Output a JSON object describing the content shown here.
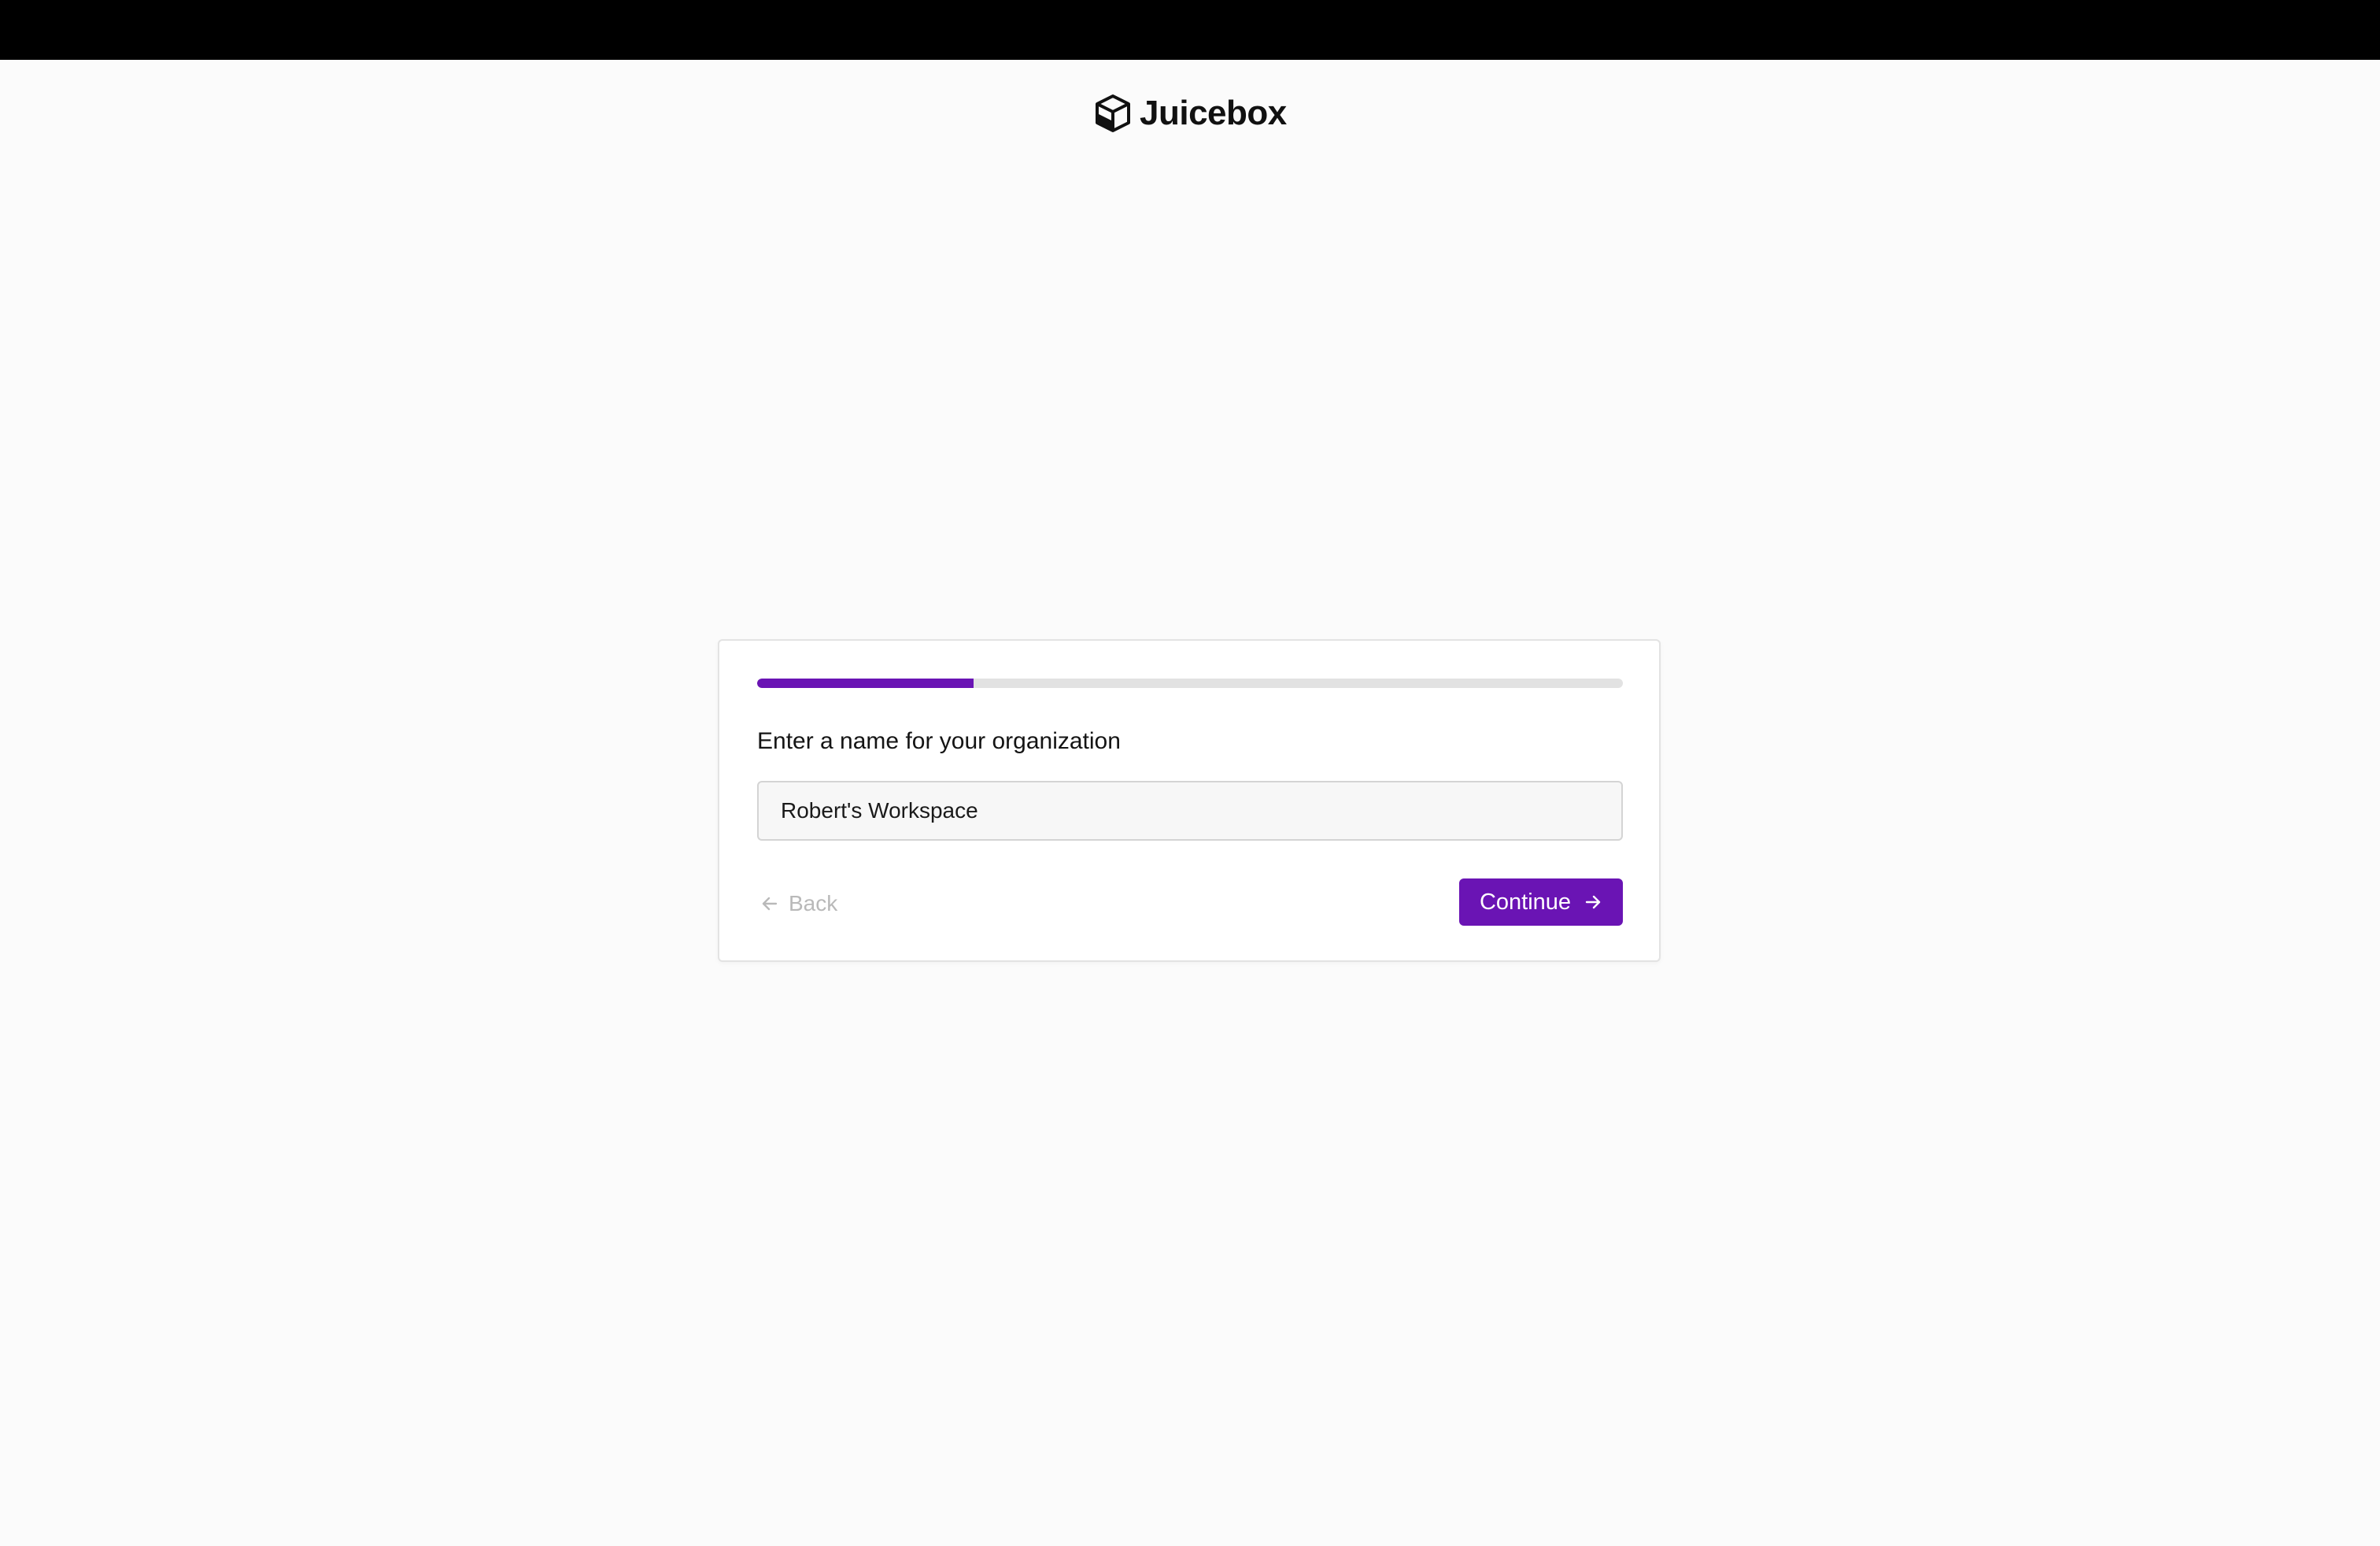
{
  "brand": {
    "name": "Juicebox",
    "logo_icon": "cube-icon"
  },
  "onboarding": {
    "progress_fraction": 0.25,
    "prompt": "Enter a name for your organization",
    "org_name_value": "Robert's Workspace",
    "back_label": "Back",
    "back_icon": "arrow-left-icon",
    "continue_label": "Continue",
    "continue_icon": "arrow-right-icon"
  },
  "colors": {
    "accent": "#6a14b4",
    "progress_track": "#e2e2e2",
    "top_bar": "#000000",
    "page_background": "#fbfbfb",
    "disabled_text": "#b9b9b9"
  }
}
